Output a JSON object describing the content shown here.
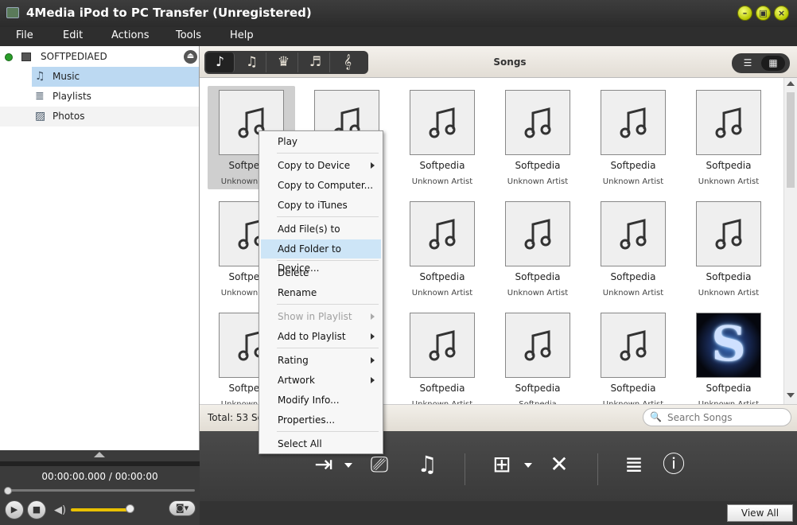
{
  "window": {
    "title": "4Media iPod to PC Transfer (Unregistered)",
    "min_label": "–",
    "max_label": "▣",
    "close_label": "×"
  },
  "menu": [
    "File",
    "Edit",
    "Actions",
    "Tools",
    "Help"
  ],
  "tree": {
    "device": "SOFTPEDIAED",
    "items": [
      {
        "label": "Music",
        "icon": "music-note-icon",
        "selected": true
      },
      {
        "label": "Playlists",
        "icon": "playlist-icon",
        "selected": false
      },
      {
        "label": "Photos",
        "icon": "photo-icon",
        "selected": false
      }
    ]
  },
  "player": {
    "time": "00:00:00.000 / 00:00:00",
    "volume_level": 0.92,
    "progress": 0
  },
  "toolbar": {
    "categories": [
      "music-note-icon",
      "music-video-icon",
      "podcast-icon",
      "guitar-icon",
      "ringtone-icon"
    ],
    "section_title": "Songs",
    "views": [
      "list-view-icon",
      "grid-view-icon"
    ]
  },
  "songs": [
    {
      "title": "Softpedia",
      "artist": "Unknown Artist",
      "art": "note"
    },
    {
      "title": "Softpedia",
      "artist": "Unknown Artist",
      "art": "note"
    },
    {
      "title": "Softpedia",
      "artist": "Unknown Artist",
      "art": "note"
    },
    {
      "title": "Softpedia",
      "artist": "Unknown Artist",
      "art": "note"
    },
    {
      "title": "Softpedia",
      "artist": "Unknown Artist",
      "art": "note"
    },
    {
      "title": "Softpedia",
      "artist": "Unknown Artist",
      "art": "note"
    },
    {
      "title": "Softpedia",
      "artist": "Unknown Artist",
      "art": "note"
    },
    {
      "title": "Softpedia",
      "artist": "Unknown Artist",
      "art": "note"
    },
    {
      "title": "Softpedia",
      "artist": "Unknown Artist",
      "art": "note"
    },
    {
      "title": "Softpedia",
      "artist": "Unknown Artist",
      "art": "note"
    },
    {
      "title": "Softpedia",
      "artist": "Unknown Artist",
      "art": "note"
    },
    {
      "title": "Softpedia",
      "artist": "Unknown Artist",
      "art": "note"
    },
    {
      "title": "Softpedia",
      "artist": "Unknown Artist",
      "art": "note"
    },
    {
      "title": "Softpedia",
      "artist": "Unknown Artist",
      "art": "note"
    },
    {
      "title": "Softpedia",
      "artist": "Unknown Artist",
      "art": "note"
    },
    {
      "title": "Softpedia",
      "artist": "Softpedia",
      "art": "note"
    },
    {
      "title": "Softpedia",
      "artist": "Unknown Artist",
      "art": "note"
    },
    {
      "title": "Softpedia",
      "artist": "Unknown Artist",
      "art": "image",
      "art_letter": "S"
    }
  ],
  "status": {
    "total": "Total: 53 Songs",
    "search_placeholder": "Search Songs"
  },
  "actions": [
    "copy-to-device-icon",
    "copy-to-computer-icon",
    "copy-to-itunes-icon",
    "add-files-icon",
    "delete-icon",
    "add-to-playlist-icon",
    "properties-icon"
  ],
  "bottom": {
    "view_all_tasks": "View All Tasks"
  },
  "context_menu": [
    {
      "label": "Play",
      "submenu": false,
      "disabled": false
    },
    {
      "label": "Copy to Device",
      "submenu": true,
      "disabled": false
    },
    {
      "label": "Copy to Computer...",
      "submenu": false,
      "disabled": false
    },
    {
      "label": "Copy to iTunes",
      "submenu": false,
      "disabled": false
    },
    {
      "label": "Add File(s) to Device...",
      "submenu": false,
      "disabled": false
    },
    {
      "label": "Add Folder to Device...",
      "submenu": false,
      "disabled": false,
      "hover": true
    },
    {
      "label": "Delete",
      "submenu": false,
      "disabled": false
    },
    {
      "label": "Rename",
      "submenu": false,
      "disabled": false
    },
    {
      "label": "Show in Playlist",
      "submenu": true,
      "disabled": true
    },
    {
      "label": "Add to Playlist",
      "submenu": true,
      "disabled": false
    },
    {
      "label": "Rating",
      "submenu": true,
      "disabled": false
    },
    {
      "label": "Artwork",
      "submenu": true,
      "disabled": false
    },
    {
      "label": "Modify Info...",
      "submenu": false,
      "disabled": false
    },
    {
      "label": "Properties...",
      "submenu": false,
      "disabled": false
    },
    {
      "label": "Select All",
      "submenu": false,
      "disabled": false
    }
  ],
  "colors": {
    "selection": "#cde5f7",
    "tree_selected": "#bcd9f2",
    "volume": "#e8c000"
  }
}
